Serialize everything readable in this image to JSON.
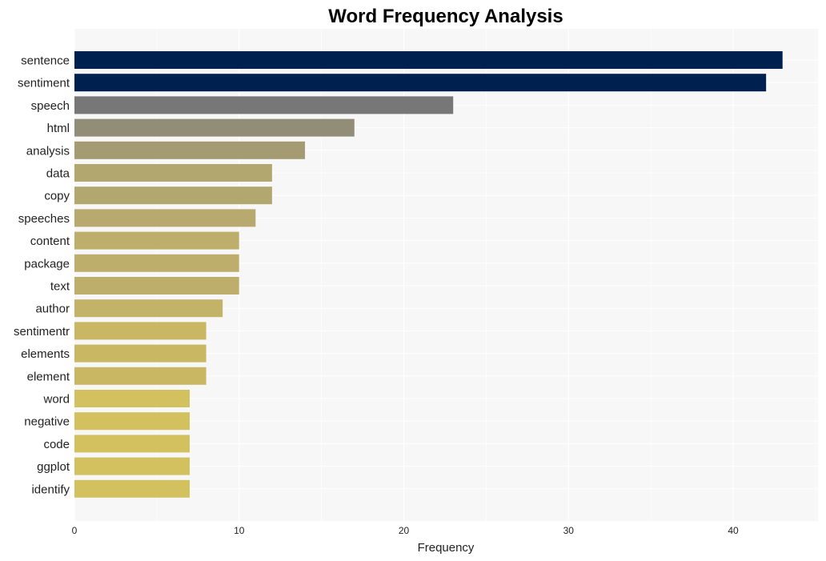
{
  "chart_data": {
    "type": "bar",
    "orientation": "horizontal",
    "title": "Word Frequency Analysis",
    "xlabel": "Frequency",
    "ylabel": "",
    "xlim": [
      0,
      45
    ],
    "xticks": [
      0,
      10,
      20,
      30,
      40
    ],
    "grid": true,
    "categories": [
      "sentence",
      "sentiment",
      "speech",
      "html",
      "analysis",
      "data",
      "copy",
      "speeches",
      "content",
      "package",
      "text",
      "author",
      "sentimentr",
      "elements",
      "element",
      "word",
      "negative",
      "code",
      "ggplot",
      "identify"
    ],
    "values": [
      43,
      42,
      23,
      17,
      14,
      12,
      12,
      11,
      10,
      10,
      10,
      9,
      8,
      8,
      8,
      7,
      7,
      7,
      7,
      7
    ],
    "colors": [
      "#00214f",
      "#00214f",
      "#777777",
      "#928d77",
      "#a49b73",
      "#b3a770",
      "#b3a770",
      "#b8aa6e",
      "#bdae6c",
      "#bdae6c",
      "#bdae6c",
      "#c3b368",
      "#c9b764",
      "#c9b764",
      "#c9b764",
      "#d3c05f",
      "#d3c05f",
      "#d3c05f",
      "#d3c05f",
      "#d3c05f"
    ],
    "panel_background": "#f7f7f7",
    "grid_color": "#ffffff"
  }
}
